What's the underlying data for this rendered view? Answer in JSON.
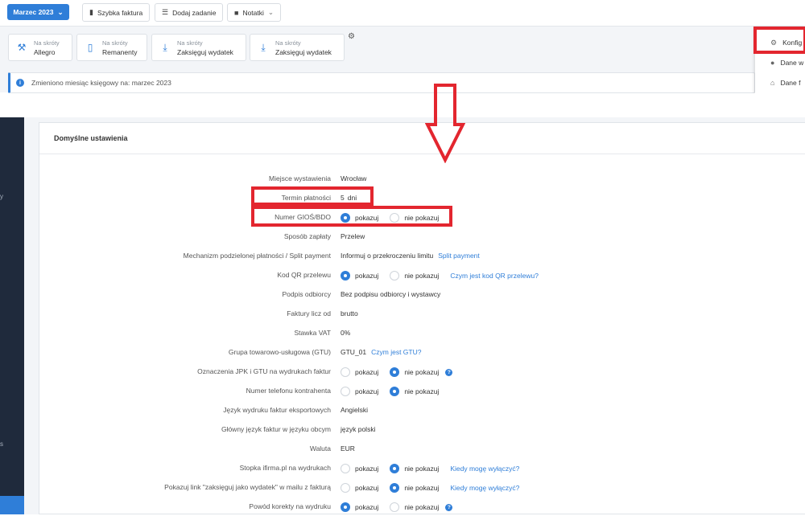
{
  "topbar": {
    "month_label": "Marzec 2023",
    "quick_invoice": "Szybka faktura",
    "add_task": "Dodaj zadanie",
    "notes": "Notatki"
  },
  "shortcuts": [
    {
      "sub": "Na skróty",
      "label": "Allegro",
      "icon": "hammer-icon"
    },
    {
      "sub": "Na skróty",
      "label": "Remanenty",
      "icon": "document-icon"
    },
    {
      "sub": "Na skróty",
      "label": "Zaksięguj wydatek",
      "icon": "document-download-icon"
    },
    {
      "sub": "Na skróty",
      "label": "Zaksięguj wydatek",
      "icon": "document-download-icon"
    }
  ],
  "notice": {
    "text": "Zmieniono miesiąc księgowy na: marzec 2023"
  },
  "dropdown": {
    "items": [
      {
        "label": "Konfig",
        "icon": "gear-icon"
      },
      {
        "label": "Dane w",
        "icon": "user-icon"
      },
      {
        "label": "Dane f",
        "icon": "bank-icon"
      }
    ]
  },
  "sidebar": {
    "fragments": [
      "y",
      "s"
    ]
  },
  "card": {
    "title": "Domyślne ustawienia"
  },
  "options": {
    "show": "pokazuj",
    "hide": "nie pokazuj"
  },
  "settings": {
    "place": {
      "label": "Miejsce wystawienia",
      "value": "Wrocław"
    },
    "payment_term": {
      "label": "Termin płatności",
      "value": "5",
      "unit": "dni"
    },
    "gios": {
      "label": "Numer GIOŚ/BDO",
      "selected": "show"
    },
    "payment_method": {
      "label": "Sposób zapłaty",
      "value": "Przelew"
    },
    "split": {
      "label": "Mechanizm podzielonej płatności / Split payment",
      "value": "Informuj o przekroczeniu limitu",
      "link": "Split payment"
    },
    "qr": {
      "label": "Kod QR przelewu",
      "selected": "show",
      "link": "Czym jest kod QR przelewu?"
    },
    "signature": {
      "label": "Podpis odbiorcy",
      "value": "Bez podpisu odbiorcy i wystawcy"
    },
    "count_from": {
      "label": "Faktury licz od",
      "value": "brutto"
    },
    "vat": {
      "label": "Stawka VAT",
      "value": "0%"
    },
    "gtu": {
      "label": "Grupa towarowo-usługowa (GTU)",
      "value": "GTU_01",
      "link": "Czym jest GTU?"
    },
    "jpk": {
      "label": "Oznaczenia JPK i GTU na wydrukach faktur",
      "selected": "hide"
    },
    "phone": {
      "label": "Numer telefonu kontrahenta",
      "selected": "hide"
    },
    "export_lang": {
      "label": "Język wydruku faktur eksportowych",
      "value": "Angielski"
    },
    "foreign_lang": {
      "label": "Główny język faktur w języku obcym",
      "value": "język polski"
    },
    "currency": {
      "label": "Waluta",
      "value": "EUR"
    },
    "footer": {
      "label": "Stopka ifirma.pl na wydrukach",
      "selected": "hide",
      "link": "Kiedy mogę wyłączyć?"
    },
    "book_link": {
      "label": "Pokazuj link \"zaksięguj jako wydatek\" w mailu z fakturą",
      "selected": "hide",
      "link": "Kiedy mogę wyłączyć?"
    },
    "correction": {
      "label": "Powód korekty na wydruku",
      "selected": "show"
    }
  },
  "colors": {
    "accent": "#2f7ed8",
    "highlight": "#e3262f",
    "sidebar": "#1f2a3c"
  }
}
